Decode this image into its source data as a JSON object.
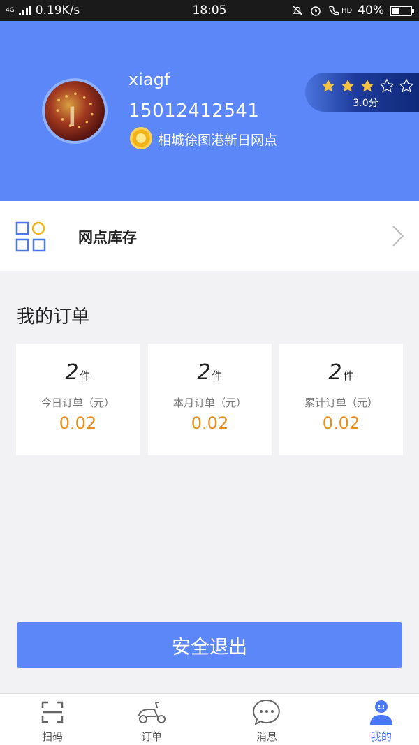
{
  "status_bar": {
    "network": "4G",
    "speed": "0.19K/s",
    "time": "18:05",
    "hd": "HD",
    "battery": "40%",
    "battery_level": 0.4
  },
  "profile": {
    "username": "xiagf",
    "phone": "15012412541",
    "site": "相城徐图港新日网点",
    "rating_stars": 3,
    "rating_max": 5,
    "rating_text": "3.0分"
  },
  "inventory": {
    "label": "网点库存"
  },
  "orders": {
    "title": "我的订单",
    "cards": [
      {
        "count": "2",
        "unit": "件",
        "label": "今日订单（元）",
        "amount": "0.02"
      },
      {
        "count": "2",
        "unit": "件",
        "label": "本月订单（元）",
        "amount": "0.02"
      },
      {
        "count": "2",
        "unit": "件",
        "label": "累计订单（元）",
        "amount": "0.02"
      }
    ]
  },
  "logout_label": "安全退出",
  "tabs": [
    {
      "label": "扫码",
      "icon": "scan-icon"
    },
    {
      "label": "订单",
      "icon": "scooter-icon"
    },
    {
      "label": "消息",
      "icon": "chat-icon"
    },
    {
      "label": "我的",
      "icon": "user-icon",
      "active": true
    }
  ],
  "colors": {
    "primary": "#5b87f9",
    "amount": "#e88e1c",
    "star": "#f5c242"
  }
}
